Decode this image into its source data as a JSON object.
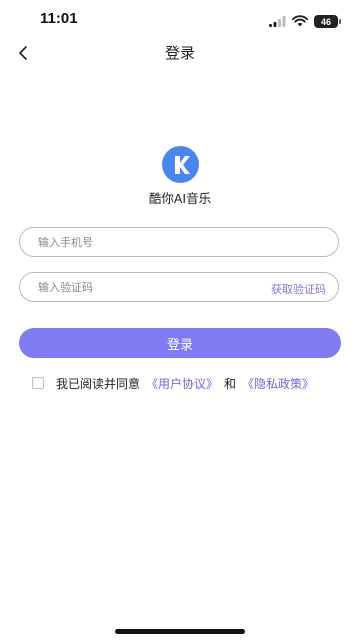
{
  "status_bar": {
    "time": "11:01",
    "battery": "46",
    "icons": [
      "signal-icon",
      "wifi-icon",
      "battery-icon"
    ]
  },
  "nav": {
    "title": "登录",
    "back_icon": "chevron-left-icon"
  },
  "app": {
    "name": "酷你AI音乐",
    "logo_letter": "K",
    "logo_color": "#4a86ef"
  },
  "form": {
    "phone_placeholder": "输入手机号",
    "phone_value": "",
    "code_placeholder": "输入验证码",
    "code_value": "",
    "get_code_label": "获取验证码",
    "login_label": "登录"
  },
  "agreement": {
    "checked": false,
    "prefix": "我已阅读并同意",
    "user_agreement": "《用户协议》",
    "and": "和",
    "privacy_policy": "《隐私政策》"
  },
  "colors": {
    "accent": "#7e7cf0",
    "link": "#6d6bd3",
    "logo": "#4a86ef"
  }
}
